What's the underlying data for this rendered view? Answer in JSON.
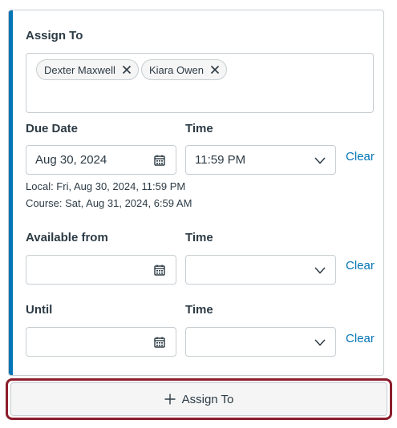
{
  "assign_to": {
    "label": "Assign To",
    "tags": [
      {
        "name": "Dexter Maxwell"
      },
      {
        "name": "Kiara Owen"
      }
    ]
  },
  "due": {
    "date_label": "Due Date",
    "time_label": "Time",
    "date_value": "Aug 30, 2024",
    "time_value": "11:59 PM",
    "clear_label": "Clear",
    "local_note": "Local: Fri, Aug 30, 2024, 11:59 PM",
    "course_note": "Course: Sat, Aug 31, 2024, 6:59 AM"
  },
  "available_from": {
    "date_label": "Available from",
    "time_label": "Time",
    "date_value": "",
    "time_value": "",
    "clear_label": "Clear"
  },
  "until": {
    "date_label": "Until",
    "time_label": "Time",
    "date_value": "",
    "time_value": "",
    "clear_label": "Clear"
  },
  "assign_button": {
    "label": "Assign To",
    "icon": "plus-icon"
  },
  "colors": {
    "accent": "#0374b5",
    "focus_ring": "#8b1d2c",
    "text": "#2d3b45",
    "border": "#c7cdd1"
  }
}
